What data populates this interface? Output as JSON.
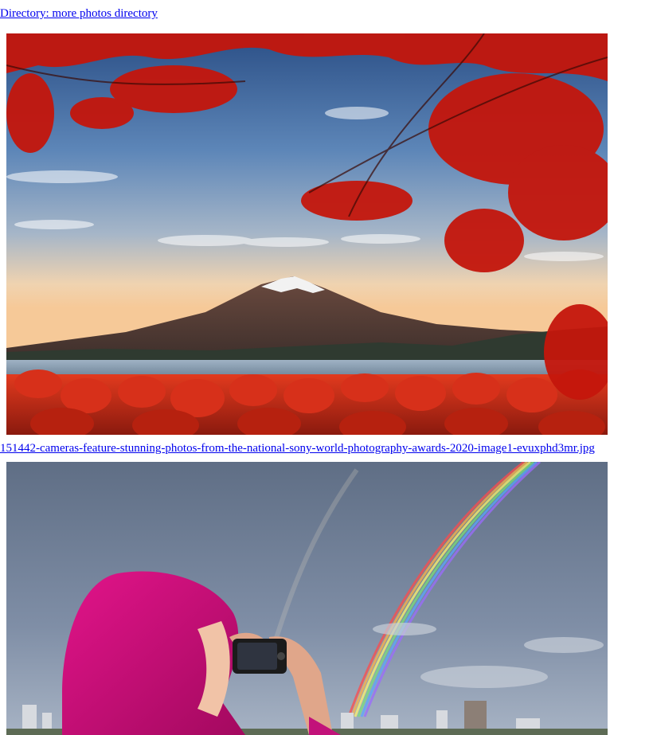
{
  "directory_link": {
    "text": "Directory: more photos directory"
  },
  "file_link": {
    "text": "151442-cameras-feature-stunning-photos-from-the-national-sony-world-photography-awards-2020-image1-evuxphd3mr.jpg"
  },
  "images": [
    {
      "subject": "mount-fuji-autumn-maple-photo"
    },
    {
      "subject": "person-photographing-rainbow-photo"
    }
  ],
  "colors": {
    "link": "#0000ee",
    "background": "#ffffff"
  }
}
